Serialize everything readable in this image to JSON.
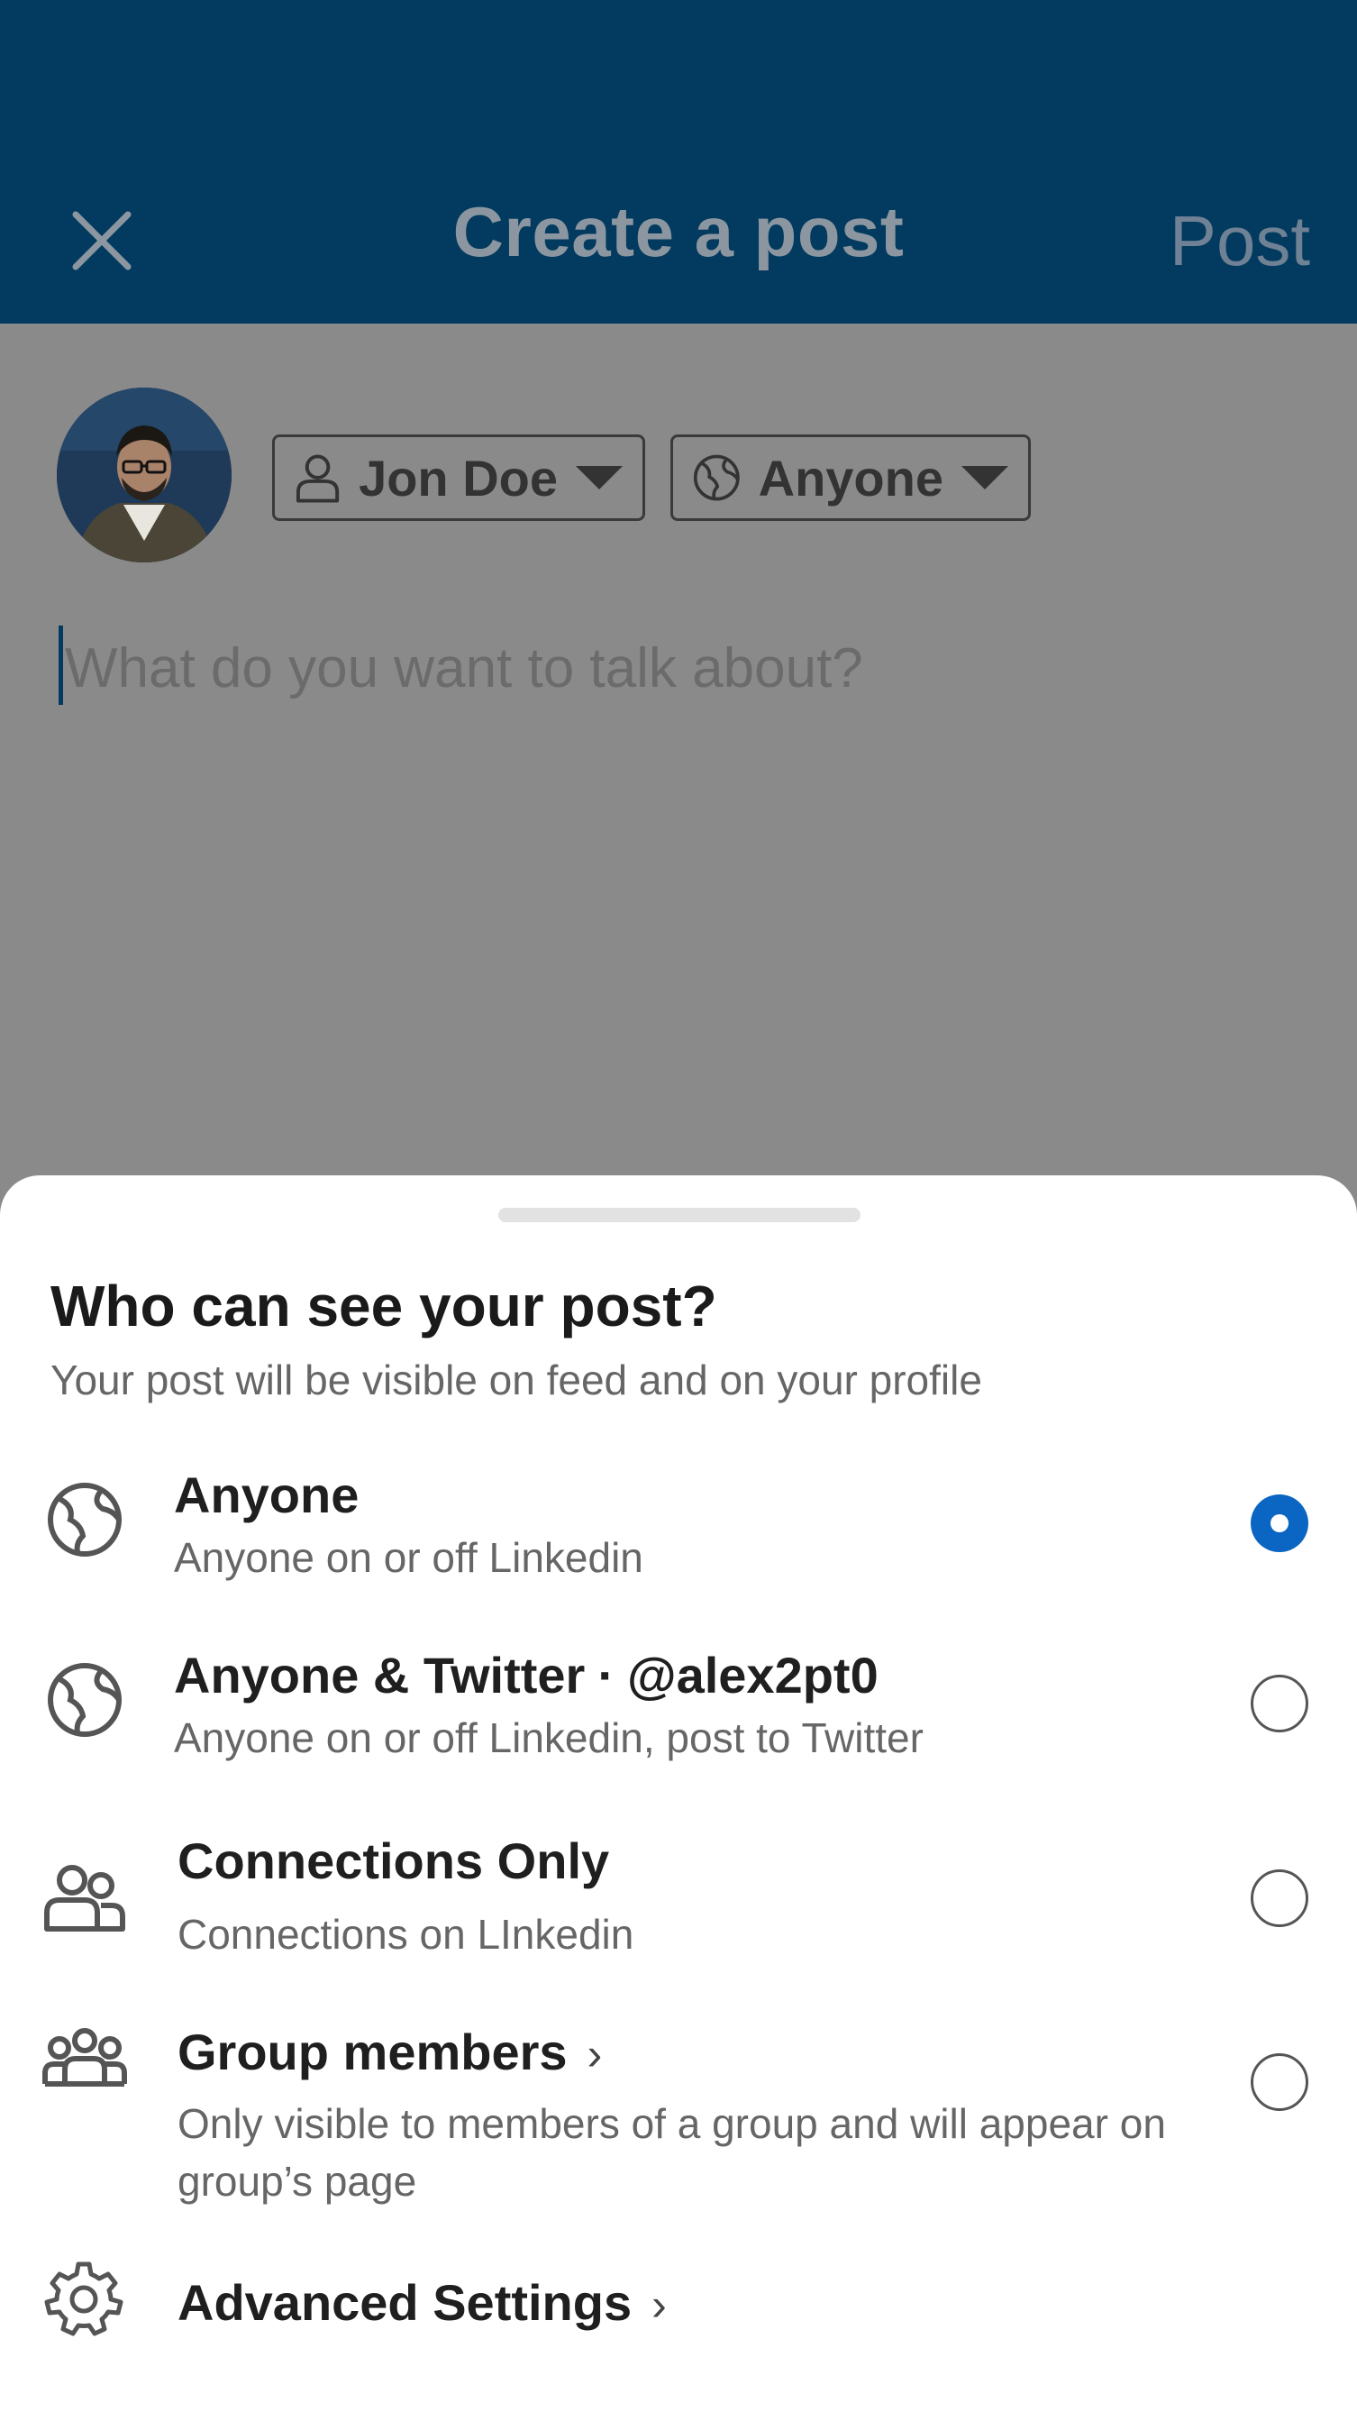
{
  "header": {
    "title": "Create a post",
    "post_label": "Post",
    "close_icon": "close-icon"
  },
  "composer": {
    "author_name": "Jon Doe",
    "audience_label": "Anyone",
    "placeholder": "What do you want to talk about?"
  },
  "sheet": {
    "title": "Who can see your post?",
    "subtitle": "Your post will be visible on feed and on your profile",
    "options": [
      {
        "title": "Anyone",
        "description": "Anyone on or off Linkedin",
        "icon": "globe-icon",
        "selected": true
      },
      {
        "title": "Anyone & Twitter",
        "handle": "@alex2pt0",
        "separator": "·",
        "description": "Anyone on or off Linkedin, post to Twitter",
        "icon": "globe-icon",
        "selected": false
      },
      {
        "title": "Connections Only",
        "description": "Connections on LInkedin",
        "icon": "connections-icon",
        "selected": false
      },
      {
        "title": "Group members",
        "chevron": "›",
        "description": "Only visible to members of a group and will appear on group’s page",
        "icon": "group-icon",
        "selected": false
      }
    ],
    "advanced": {
      "title": "Advanced Settings",
      "chevron": "›",
      "icon": "gear-icon"
    }
  },
  "colors": {
    "header_bg": "#023b5f",
    "overlay_bg": "#8a8a8a",
    "accent": "#0a66c2"
  }
}
